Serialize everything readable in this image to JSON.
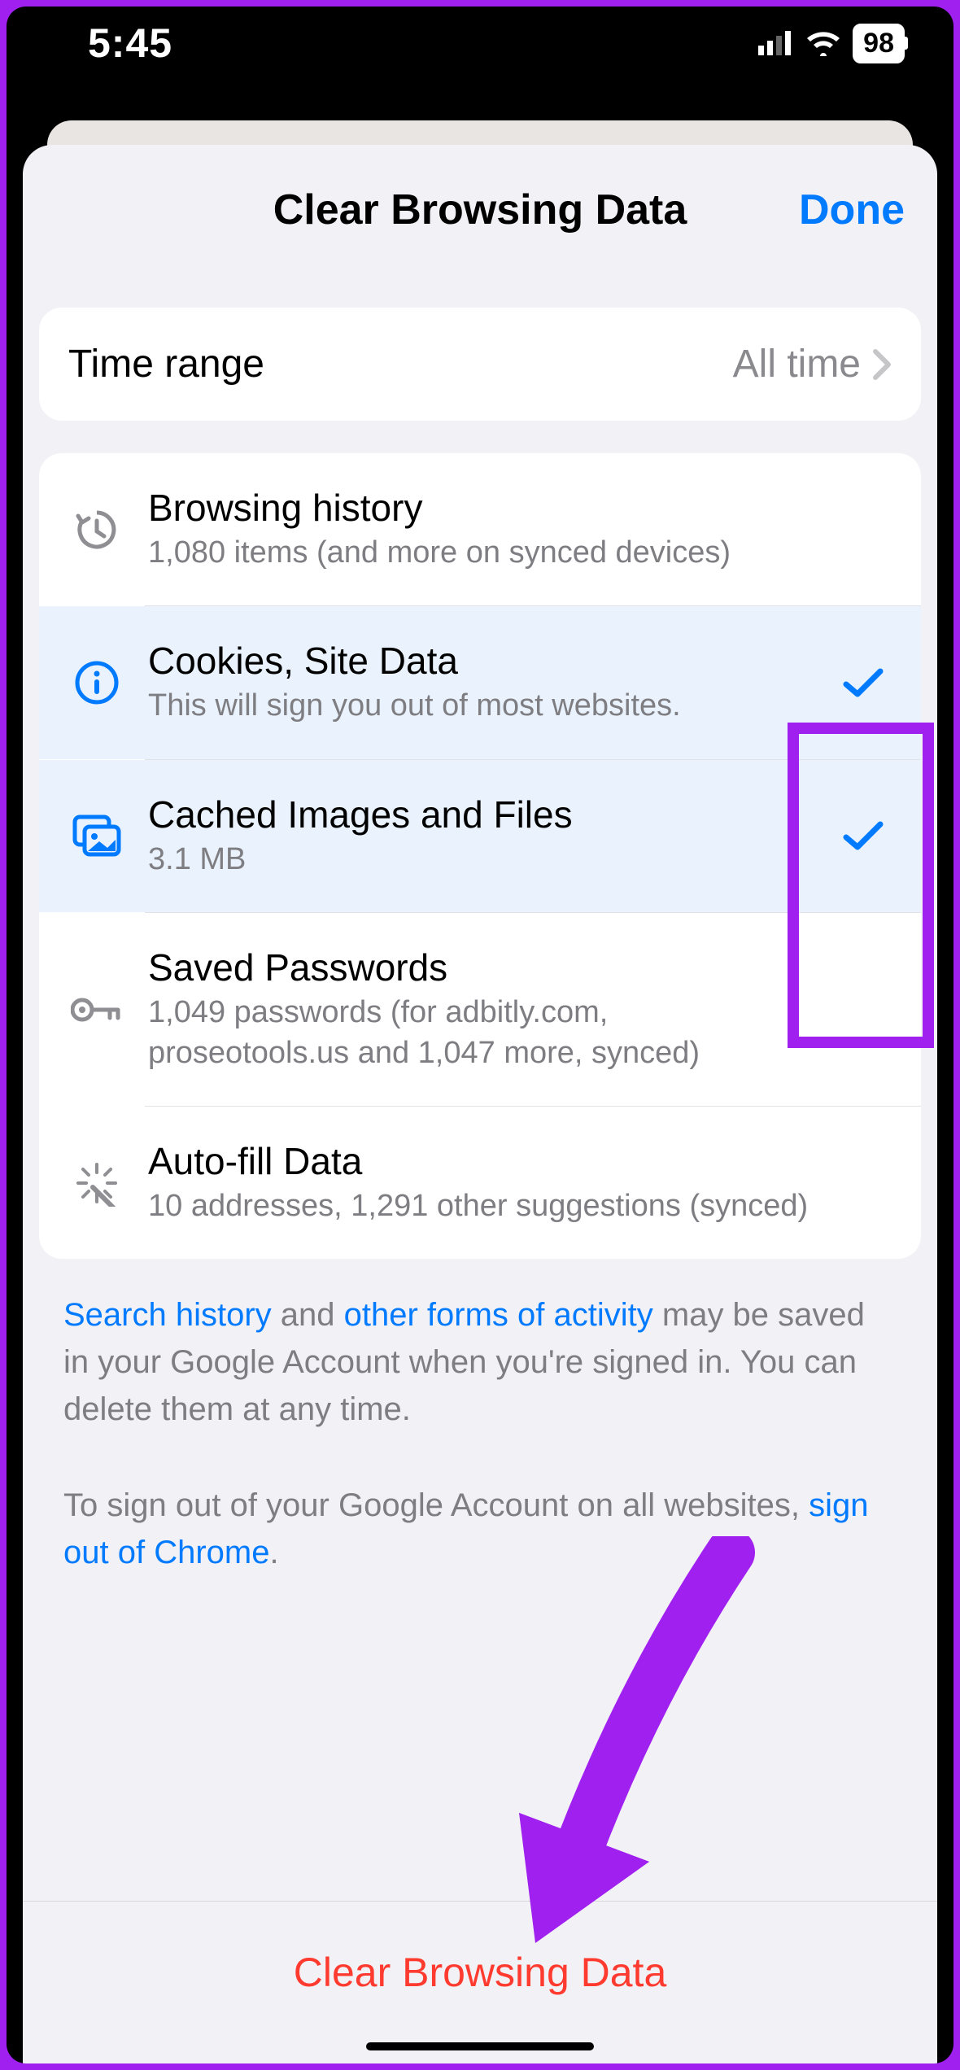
{
  "status": {
    "time": "5:45",
    "battery": "98"
  },
  "sheet": {
    "title": "Clear Browsing Data",
    "done": "Done"
  },
  "time_range": {
    "label": "Time range",
    "value": "All time"
  },
  "items": {
    "history": {
      "title": "Browsing history",
      "sub": "1,080 items (and more on synced devices)"
    },
    "cookies": {
      "title": "Cookies, Site Data",
      "sub": "This will sign you out of most websites."
    },
    "cache": {
      "title": "Cached Images and Files",
      "sub": "3.1 MB"
    },
    "passwords": {
      "title": "Saved Passwords",
      "sub": "1,049 passwords (for adbitly.com, proseotools.us and 1,047 more, synced)"
    },
    "autofill": {
      "title": "Auto-fill Data",
      "sub": "10 addresses, 1,291 other suggestions (synced)"
    }
  },
  "footer1": {
    "link1": "Search history",
    "mid1": " and ",
    "link2": "other forms of activity",
    "rest": " may be saved in your Google Account when you're signed in. You can delete them at any time."
  },
  "footer2": {
    "pre": "To sign out of your Google Account on all websites, ",
    "link": "sign out of Chrome",
    "post": "."
  },
  "action": "Clear Browsing Data"
}
